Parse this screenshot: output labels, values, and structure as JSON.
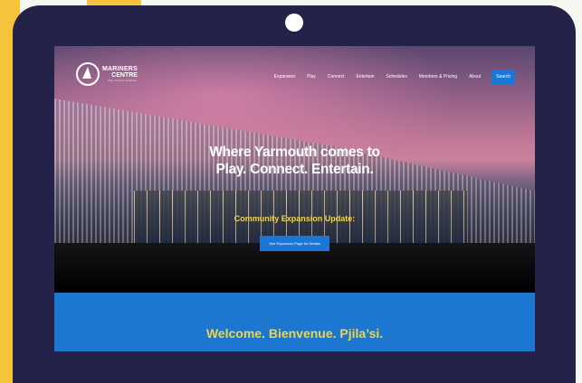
{
  "site": {
    "logo": {
      "line1": "MARINERS",
      "line2": "CENTRE",
      "tagline": "Play. Connect. Entertain."
    },
    "nav": {
      "items": [
        "Expansion",
        "Play",
        "Connect",
        "Entertain",
        "Schedules",
        "Members & Pricing",
        "About"
      ],
      "search_label": "Search"
    },
    "hero": {
      "headline_line1": "Where Yarmouth comes to",
      "headline_line2": "Play. Connect. Entertain.",
      "subheadline": "Community Expansion Update:",
      "cta_label": "See Expansion Page for Details"
    },
    "welcome": {
      "text": "Welcome. Bienvenue. Pjila’si."
    }
  },
  "colors": {
    "device_frame": "#25224a",
    "accent_blue": "#1b77d6",
    "accent_yellow": "#f0d54a",
    "side_yellow": "#f5c43a"
  }
}
